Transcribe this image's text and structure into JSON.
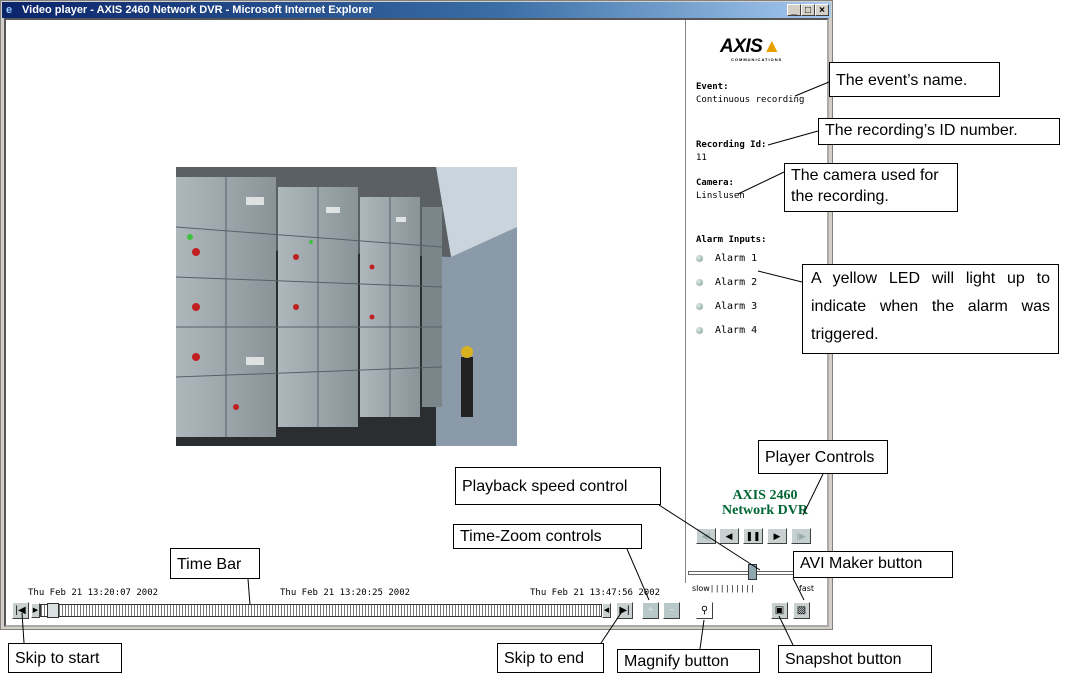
{
  "window": {
    "title": "Video player - AXIS 2460 Network DVR - Microsoft Internet Explorer",
    "controls": [
      "_",
      "□",
      "×"
    ]
  },
  "logo": {
    "brand": "AXIS",
    "sub": "COMMUNICATIONS"
  },
  "info": {
    "event_label": "Event:",
    "event_value": "Continuous recording",
    "recording_label": "Recording Id:",
    "recording_value": "11",
    "camera_label": "Camera:",
    "camera_value": "Linslusen",
    "alarm_label": "Alarm Inputs:",
    "alarms": [
      "Alarm 1",
      "Alarm 2",
      "Alarm 3",
      "Alarm 4"
    ]
  },
  "dvr_brand": {
    "line1": "AXIS 2460",
    "line2": "Network DVR"
  },
  "player_controls": [
    "step-back",
    "play-reverse",
    "pause",
    "play",
    "step-forward"
  ],
  "speed": {
    "slow": "slow",
    "fast": "fast"
  },
  "timestamps": [
    "Thu Feb 21 13:20:07 2002",
    "Thu Feb 21 13:20:25 2002",
    "Thu Feb 21 13:47:56 2002"
  ],
  "callouts": {
    "event_name": "The event’s name.",
    "recording_id": "The recording’s ID number.",
    "camera_used": "The camera used for the recording.",
    "yellow_led": "A yellow LED will light up to indicate when the alarm was triggered.",
    "player_controls": "Player Controls",
    "playback_speed": "Playback speed control",
    "time_zoom": "Time-Zoom controls",
    "time_bar": "Time Bar",
    "avi_maker": "AVI Maker button",
    "skip_start": "Skip to start",
    "skip_end": "Skip to end",
    "magnify": "Magnify button",
    "snapshot": "Snapshot button"
  },
  "colors": {
    "title_bar": "#0a246a",
    "dvr_brand": "#006633",
    "led_off": "#7a9a90"
  }
}
